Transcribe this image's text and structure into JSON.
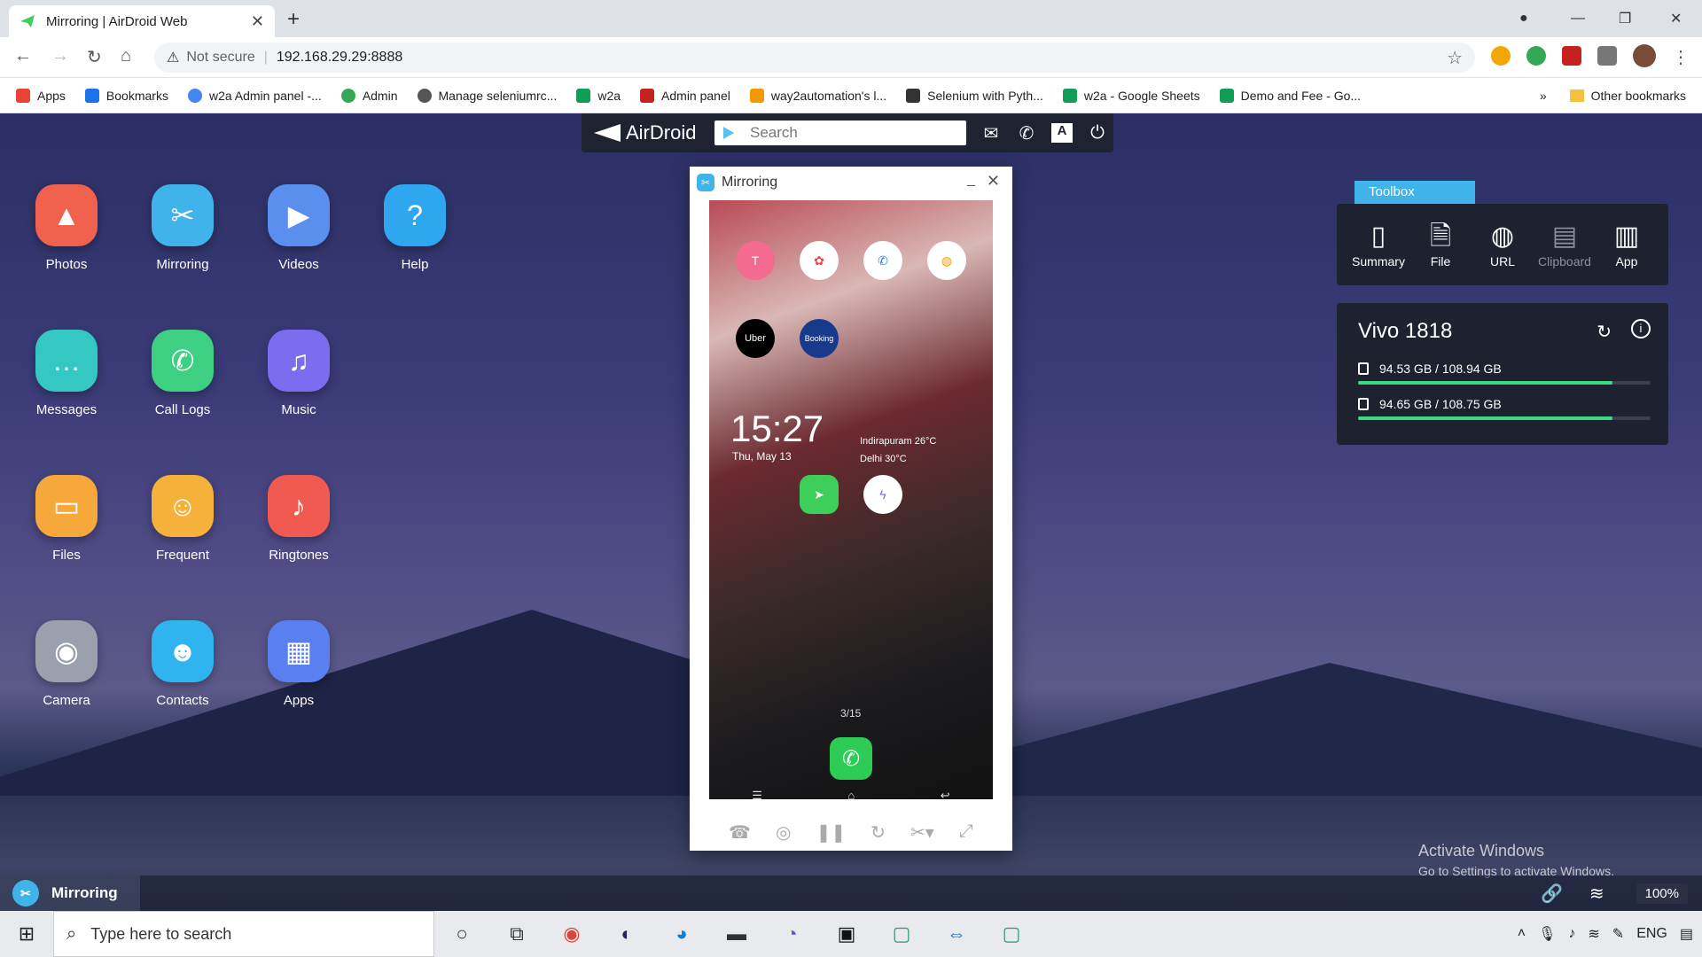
{
  "browser": {
    "tab_title": "Mirroring | AirDroid Web",
    "address_not_secure": "Not secure",
    "address_url": "192.168.29.29:8888",
    "bookmarks": [
      {
        "label": "Apps",
        "color": "#ea4335"
      },
      {
        "label": "Bookmarks",
        "color": "#1a73e8"
      },
      {
        "label": "w2a Admin panel -...",
        "color": "#4285f4"
      },
      {
        "label": "Admin",
        "color": "#34a853"
      },
      {
        "label": "Manage seleniumrc...",
        "color": "#555555"
      },
      {
        "label": "w2a",
        "color": "#0f9d58"
      },
      {
        "label": "Admin panel",
        "color": "#c5221f"
      },
      {
        "label": "way2automation's l...",
        "color": "#f29900"
      },
      {
        "label": "Selenium with Pyth...",
        "color": "#333333"
      },
      {
        "label": "w2a - Google Sheets",
        "color": "#0f9d58"
      },
      {
        "label": "Demo and Fee - Go...",
        "color": "#0f9d58"
      }
    ],
    "more_bookmarks": "»",
    "other_bookmarks": "Other bookmarks"
  },
  "airdroid": {
    "brand": "AirDroid",
    "search_placeholder": "Search"
  },
  "desktop_apps": [
    {
      "label": "Photos",
      "icon": "photo-icon",
      "color": "#f0624d",
      "glyph": "▲"
    },
    {
      "label": "Mirroring",
      "icon": "scissors-icon",
      "color": "#3fb3ea",
      "glyph": "✂"
    },
    {
      "label": "Videos",
      "icon": "play-icon",
      "color": "#5a8ff0",
      "glyph": "▶"
    },
    {
      "label": "Help",
      "icon": "help-icon",
      "color": "#2fa6f0",
      "glyph": "?"
    },
    {
      "label": "Messages",
      "icon": "chat-icon",
      "color": "#35c7c4",
      "glyph": "…"
    },
    {
      "label": "Call Logs",
      "icon": "phone-icon",
      "color": "#3dcf82",
      "glyph": "✆"
    },
    {
      "label": "Music",
      "icon": "music-icon",
      "color": "#7b6cf0",
      "glyph": "♫"
    },
    {
      "label": "Files",
      "icon": "folder-icon",
      "color": "#f7a83a",
      "glyph": "▭"
    },
    {
      "label": "Frequent",
      "icon": "contact-card-icon",
      "color": "#f6b13a",
      "glyph": "☺"
    },
    {
      "label": "Ringtones",
      "icon": "bell-icon",
      "color": "#f05a50",
      "glyph": "🔔"
    },
    {
      "label": "Camera",
      "icon": "camera-icon",
      "color": "#9aa0ad",
      "glyph": "◉"
    },
    {
      "label": "Contacts",
      "icon": "contacts-icon",
      "color": "#2fb4f0",
      "glyph": "☻"
    },
    {
      "label": "Apps",
      "icon": "grid-icon",
      "color": "#5a7ff0",
      "glyph": "▦"
    }
  ],
  "mirror_window": {
    "title": "Mirroring",
    "phone": {
      "clock": "15:27",
      "date": "Thu, May 13",
      "weather_line1": "Indirapuram 26°C",
      "weather_line2": "Delhi 30°C",
      "page_indicator": "3/15",
      "apps": [
        {
          "label": "Tips",
          "color": "#f36b8f",
          "glyph": "T"
        },
        {
          "label": "Gallery",
          "color": "#ffffff",
          "glyph": "✿"
        },
        {
          "label": "Truecaller",
          "color": "#ffffff",
          "glyph": "✆"
        },
        {
          "label": "Assistant",
          "color": "#ffffff",
          "glyph": "◍"
        },
        {
          "label": "Uber",
          "color": "#000000",
          "glyph": "Uber"
        },
        {
          "label": "Booking.com",
          "color": "#173a8c",
          "glyph": "Booking"
        },
        {
          "label": "AirDroid",
          "color": "#3dcf5a",
          "glyph": "➤"
        },
        {
          "label": "Messenger",
          "color": "#ffffff",
          "glyph": "ϟ"
        }
      ]
    }
  },
  "toolbox": {
    "tab_label": "Toolbox",
    "items": [
      {
        "label": "Summary",
        "icon": "phone-summary-icon"
      },
      {
        "label": "File",
        "icon": "file-icon"
      },
      {
        "label": "URL",
        "icon": "globe-icon"
      },
      {
        "label": "Clipboard",
        "icon": "clipboard-icon"
      },
      {
        "label": "App",
        "icon": "app-box-icon"
      }
    ]
  },
  "device": {
    "name": "Vivo 1818",
    "storage": [
      {
        "text": "94.53 GB / 108.94 GB",
        "fraction": 0.87
      },
      {
        "text": "94.65 GB / 108.75 GB",
        "fraction": 0.87
      }
    ]
  },
  "watermark": {
    "line1": "Activate Windows",
    "line2": "Go to Settings to activate Windows."
  },
  "status": {
    "active_app": "Mirroring",
    "battery": "100%"
  },
  "taskbar": {
    "search_placeholder": "Type here to search",
    "lang": "ENG"
  }
}
